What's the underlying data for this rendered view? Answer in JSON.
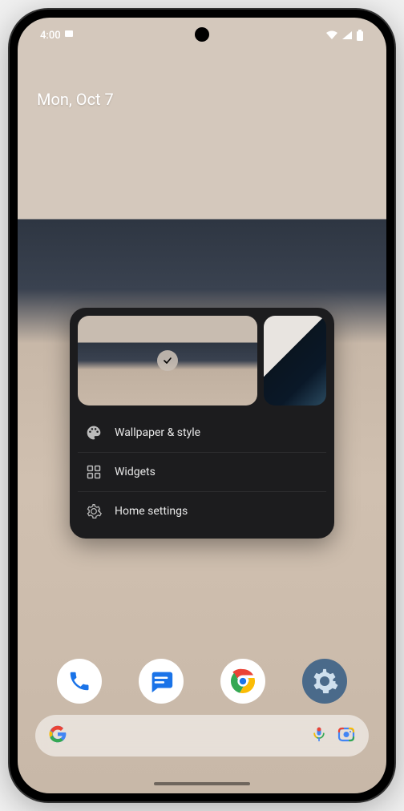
{
  "status": {
    "time": "4:00",
    "badge": "◙"
  },
  "date": "Mon, Oct 7",
  "contextMenu": {
    "items": [
      {
        "label": "Wallpaper & style"
      },
      {
        "label": "Widgets"
      },
      {
        "label": "Home settings"
      }
    ]
  },
  "dock": {
    "apps": [
      "Phone",
      "Messages",
      "Chrome",
      "Settings"
    ]
  }
}
